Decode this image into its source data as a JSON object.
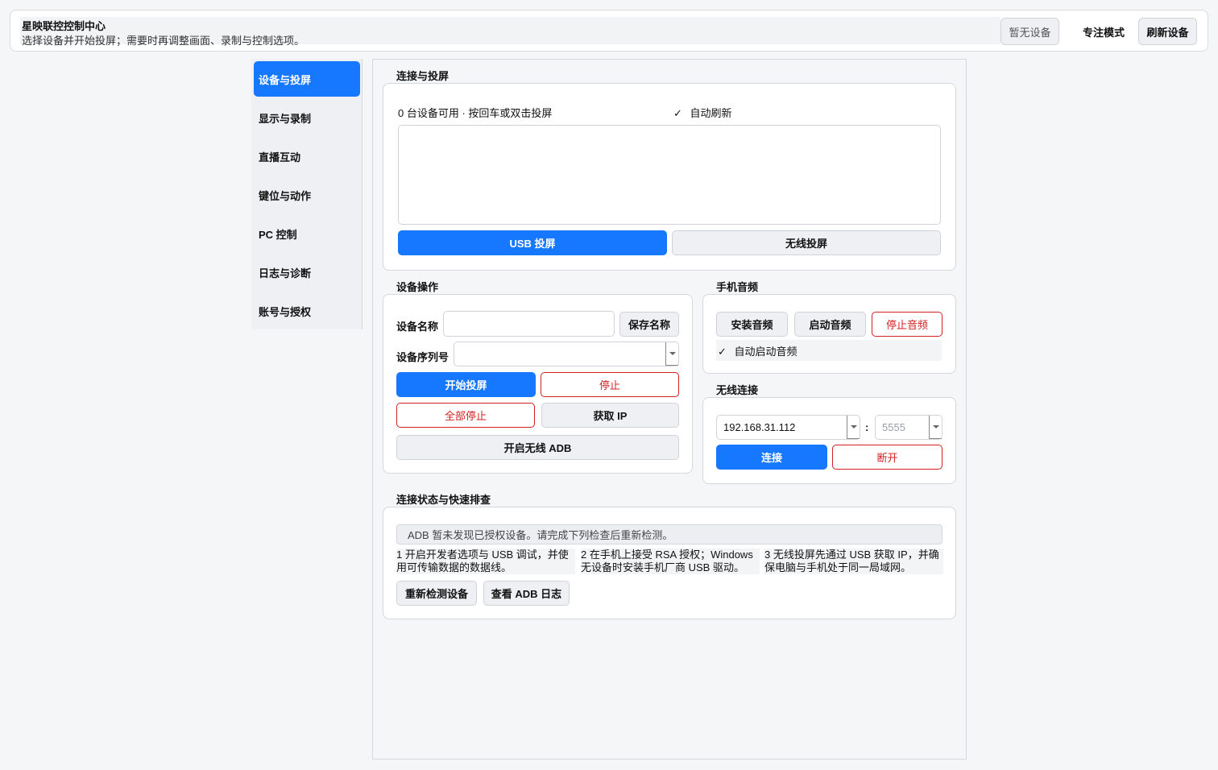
{
  "header": {
    "title": "星映联控控制中心",
    "subtitle": "选择设备并开始投屏；需要时再调整画面、录制与控制选项。",
    "device_status": "暂无设备",
    "focus_mode": "专注模式",
    "refresh_devices": "刷新设备"
  },
  "sidebar": {
    "items": [
      {
        "label": "设备与投屏",
        "active": true
      },
      {
        "label": "显示与录制"
      },
      {
        "label": "直播互动"
      },
      {
        "label": "键位与动作"
      },
      {
        "label": "PC 控制"
      },
      {
        "label": "日志与诊断"
      },
      {
        "label": "账号与授权"
      }
    ]
  },
  "connect": {
    "title": "连接与投屏",
    "device_count": "0 台设备可用 · 按回车或双击投屏",
    "auto_refresh_check": "✓",
    "auto_refresh_label": "自动刷新",
    "usb_button": "USB 投屏",
    "wireless_button": "无线投屏"
  },
  "device_ops": {
    "title": "设备操作",
    "name_label": "设备名称",
    "name_value": "",
    "save_name": "保存名称",
    "serial_label": "设备序列号",
    "serial_value": "",
    "start": "开始投屏",
    "stop": "停止",
    "stop_all": "全部停止",
    "get_ip": "获取 IP",
    "enable_wireless_adb": "开启无线 ADB"
  },
  "audio": {
    "title": "手机音频",
    "install": "安装音频",
    "start": "启动音频",
    "stop": "停止音频",
    "auto_start_check": "✓",
    "auto_start_label": "自动启动音频"
  },
  "wireless": {
    "title": "无线连接",
    "ip_value": "192.168.31.112",
    "separator": ":",
    "port_placeholder": "5555",
    "connect": "连接",
    "disconnect": "断开"
  },
  "status": {
    "title": "连接状态与快速排查",
    "message": "ADB 暂未发现已授权设备。请完成下列检查后重新检测。",
    "steps": [
      "1  开启开发者选项与 USB 调试，并使用可传输数据的数据线。",
      "2  在手机上接受 RSA 授权；Windows 无设备时安装手机厂商 USB 驱动。",
      "3  无线投屏先通过 USB 获取 IP，并确保电脑与手机处于同一局域网。"
    ],
    "recheck": "重新检测设备",
    "view_log": "查看 ADB 日志"
  },
  "colors": {
    "accent": "#1677ff",
    "danger": "#d42020",
    "background": "#f5f6f8"
  }
}
